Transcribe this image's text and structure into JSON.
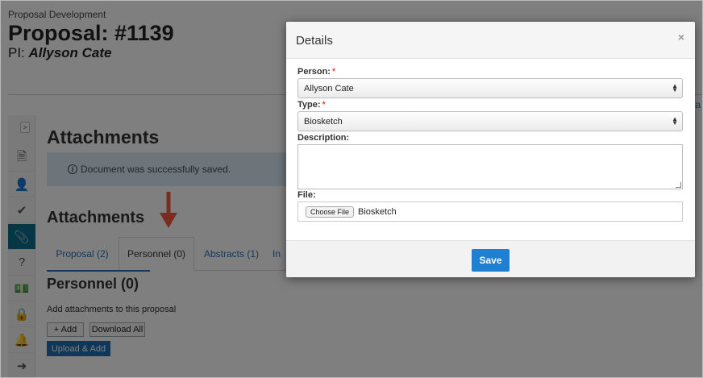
{
  "header": {
    "breadcrumb": "Proposal Development",
    "title": "Proposal: #1139",
    "pi_label": "PI:",
    "pi_name": "Allyson Cate",
    "edge_link": "la"
  },
  "sidebar": {
    "toggle": ">",
    "items": [
      {
        "icon": "document-icon",
        "glyph": "🗎"
      },
      {
        "icon": "person-icon",
        "glyph": "👤"
      },
      {
        "icon": "checkmark-icon",
        "glyph": "✔"
      },
      {
        "icon": "paperclip-icon",
        "glyph": "📎"
      },
      {
        "icon": "question-icon",
        "glyph": "?"
      },
      {
        "icon": "money-icon",
        "glyph": "💵"
      },
      {
        "icon": "lock-icon",
        "glyph": "🔒"
      },
      {
        "icon": "bell-icon",
        "glyph": "🔔"
      },
      {
        "icon": "exit-icon",
        "glyph": "➜"
      }
    ]
  },
  "main": {
    "title": "Attachments",
    "alert": "Document was successfully saved.",
    "alert_icon": "i",
    "section_title": "Attachments",
    "tabs": [
      "Proposal (2)",
      "Personnel (0)",
      "Abstracts (1)",
      "In"
    ],
    "active_tab": 1,
    "pane_title": "Personnel (0)",
    "pane_text": "Add attachments to this proposal",
    "add_label": "+ Add",
    "download_all_label": "Download All",
    "upload_add_label": "Upload & Add"
  },
  "modal": {
    "title": "Details",
    "close": "×",
    "person_label": "Person:",
    "person_value": "Allyson Cate",
    "type_label": "Type:",
    "type_value": "Biosketch",
    "required_mark": "*",
    "description_label": "Description:",
    "description_value": "",
    "file_label": "File:",
    "choose_file_label": "Choose File",
    "file_name": "Biosketch",
    "save_label": "Save"
  },
  "colors": {
    "accent": "#1f7fd1",
    "sidebar_active": "#0f6e8f",
    "arrow": "#f15a3e",
    "required": "#d9534f"
  }
}
